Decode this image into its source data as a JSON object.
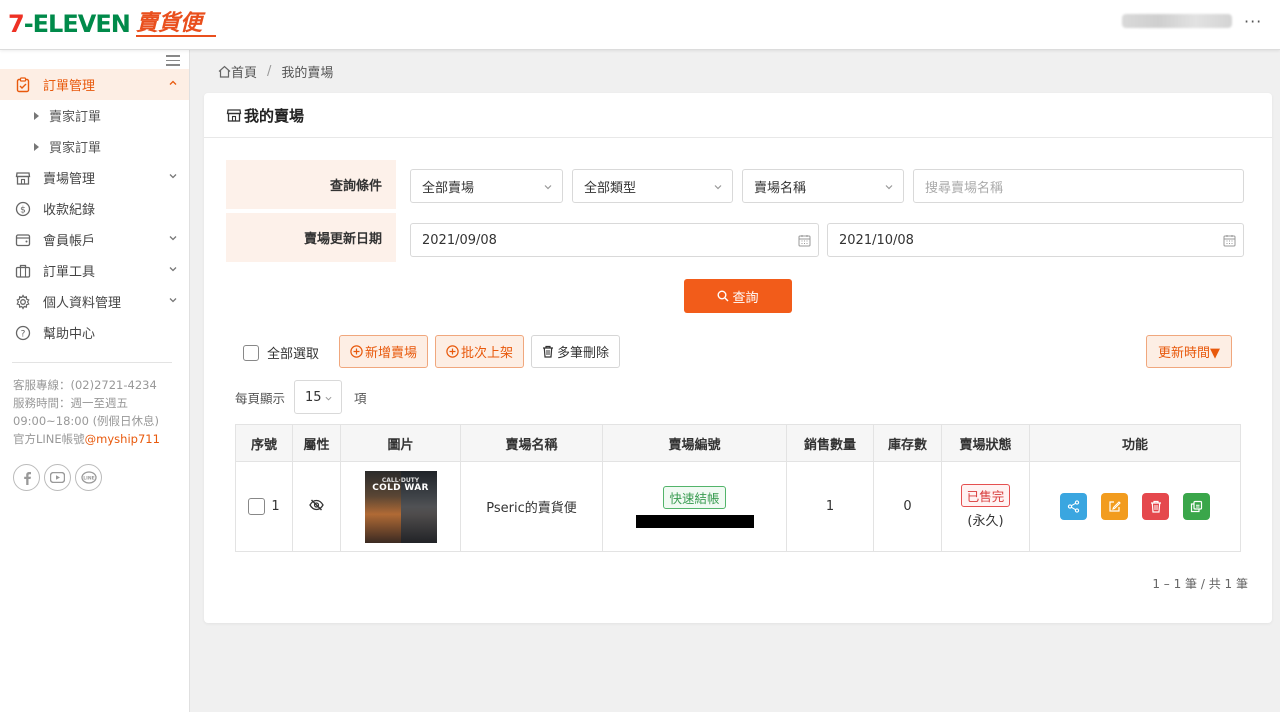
{
  "header": {
    "logo_711_seven": "7",
    "logo_711_rest": "-ELEVEN",
    "logo_ship": "賣貨便",
    "more": "···"
  },
  "sidebar": {
    "items": [
      {
        "label": "訂單管理",
        "icon": "clipboard-icon",
        "expanded": true
      },
      {
        "label": "賣家訂單",
        "sub": true
      },
      {
        "label": "買家訂單",
        "sub": true
      },
      {
        "label": "賣場管理",
        "icon": "store-icon"
      },
      {
        "label": "收款紀錄",
        "icon": "dollar-icon"
      },
      {
        "label": "會員帳戶",
        "icon": "wallet-icon"
      },
      {
        "label": "訂單工具",
        "icon": "briefcase-icon"
      },
      {
        "label": "個人資料管理",
        "icon": "gear-icon"
      },
      {
        "label": "幫助中心",
        "icon": "help-icon"
      }
    ],
    "contact": {
      "hotline": "客服專線：(02)2721-4234",
      "hours1": "服務時間：週一至週五",
      "hours2": "09:00~18:00 (例假日休息)",
      "line_prefix": "官方LINE帳號",
      "line_id": "@myship711"
    },
    "social": [
      "facebook-icon",
      "youtube-icon",
      "line-icon"
    ]
  },
  "breadcrumb": {
    "home": "首頁",
    "sep": "/",
    "current": "我的賣場"
  },
  "card": {
    "title": "我的賣場"
  },
  "filters": {
    "cond_label": "查詢條件",
    "date_label": "賣場更新日期",
    "store_select": "全部賣場",
    "type_select": "全部類型",
    "field_select": "賣場名稱",
    "search_placeholder": "搜尋賣場名稱",
    "date_from": "2021/09/08",
    "date_to": "2021/10/08",
    "search_button": "查詢"
  },
  "toolbar": {
    "select_all": "全部選取",
    "add_store": "新增賣場",
    "batch_publish": "批次上架",
    "batch_delete": "多筆刪除",
    "sort": "更新時間▼"
  },
  "paging": {
    "per_page_label": "每頁顯示",
    "per_page_value": "15",
    "unit": "項",
    "summary": "1 – 1 筆 / 共 1 筆"
  },
  "table": {
    "headers": [
      "序號",
      "屬性",
      "圖片",
      "賣場名稱",
      "賣場編號",
      "銷售數量",
      "庫存數",
      "賣場狀態",
      "功能"
    ],
    "rows": [
      {
        "seq": "1",
        "cover_line1": "CALL·DUTY",
        "cover_line2": "COLD WAR",
        "name": "Pseric的賣貨便",
        "tag": "快速結帳",
        "sales": "1",
        "stock": "0",
        "status": "已售完",
        "status_note": "(永久)"
      }
    ]
  },
  "colors": {
    "accent": "#f25c1a",
    "share": "#3aa6e0",
    "edit": "#f29c1f",
    "delete": "#e5484d",
    "copy": "#3aa64a"
  }
}
